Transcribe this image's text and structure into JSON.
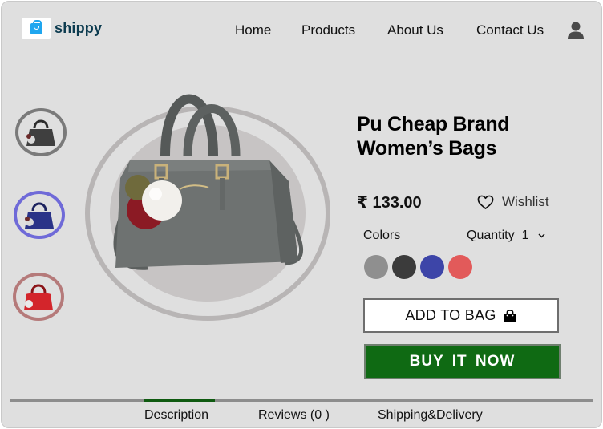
{
  "brand": {
    "name": "shippy",
    "logo_icon": "shopping-bag-icon",
    "logo_color": "#1fa6ef"
  },
  "nav": {
    "items": [
      "Home",
      "Products",
      "About Us",
      "Contact Us"
    ],
    "user_icon": "user-icon"
  },
  "thumbnails": [
    {
      "name": "grey-bag",
      "color": "#4a4a4a",
      "ring": "#7a7a7a"
    },
    {
      "name": "blue-bag",
      "color": "#2a3388",
      "ring": "#6f6ad8"
    },
    {
      "name": "red-bag",
      "color": "#d3252b",
      "ring": "#b57a7a"
    }
  ],
  "product": {
    "title_line1": "Pu Cheap Brand",
    "title_line2": "Women’s Bags",
    "price": "₹ 133.00",
    "wishlist_label": "Wishlist",
    "colors_label": "Colors",
    "quantity_label": "Quantity",
    "quantity_value": "1",
    "colors": [
      "#8f8f8f",
      "#3b3b3b",
      "#3d45a8",
      "#e25a5a"
    ],
    "add_to_bag_label": "ADD TO BAG",
    "buy_now_label": "BUY IT NOW"
  },
  "tabs": {
    "items": [
      "Description",
      "Reviews (0 )",
      "Shipping&Delivery"
    ],
    "active": "Description",
    "active_color": "#0f5a10"
  },
  "colors": {
    "background": "#dfdfdf",
    "accent_green": "#0f6a13"
  }
}
